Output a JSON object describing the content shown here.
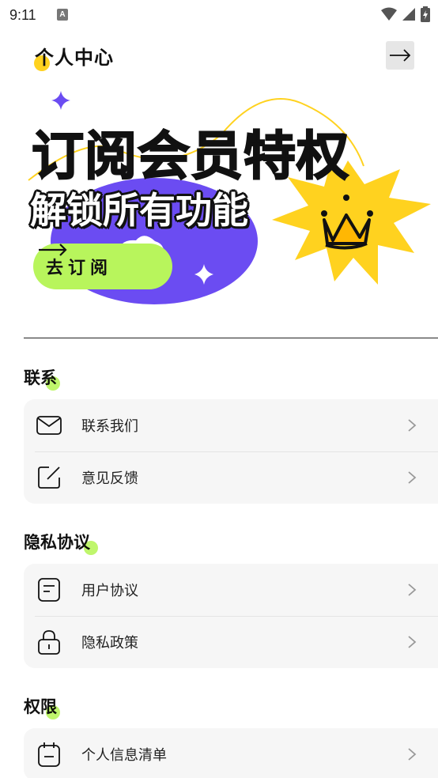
{
  "status_bar": {
    "time": "9:11",
    "notification_letter": "A",
    "icons": [
      "wifi-icon",
      "cell-signal-icon",
      "battery-charging-icon"
    ]
  },
  "header": {
    "title": "个人中心",
    "action_icon": "arrow-right-icon"
  },
  "banner": {
    "headline": "订阅会员特权",
    "subheadline": "解锁所有功能",
    "button_label": "去订阅",
    "button_icon": "arrow-right-icon",
    "colors": {
      "purple": "#6b4cf2",
      "yellow": "#ffd21f",
      "green": "#b8f55c"
    }
  },
  "sections": [
    {
      "title": "联系",
      "items": [
        {
          "label": "联系我们",
          "icon": "mail-icon"
        },
        {
          "label": "意见反馈",
          "icon": "edit-icon"
        }
      ]
    },
    {
      "title": "隐私协议",
      "items": [
        {
          "label": "用户协议",
          "icon": "document-icon"
        },
        {
          "label": "隐私政策",
          "icon": "lock-icon"
        }
      ]
    },
    {
      "title": "权限",
      "items": [
        {
          "label": "个人信息清单",
          "icon": "calendar-icon"
        }
      ]
    }
  ]
}
